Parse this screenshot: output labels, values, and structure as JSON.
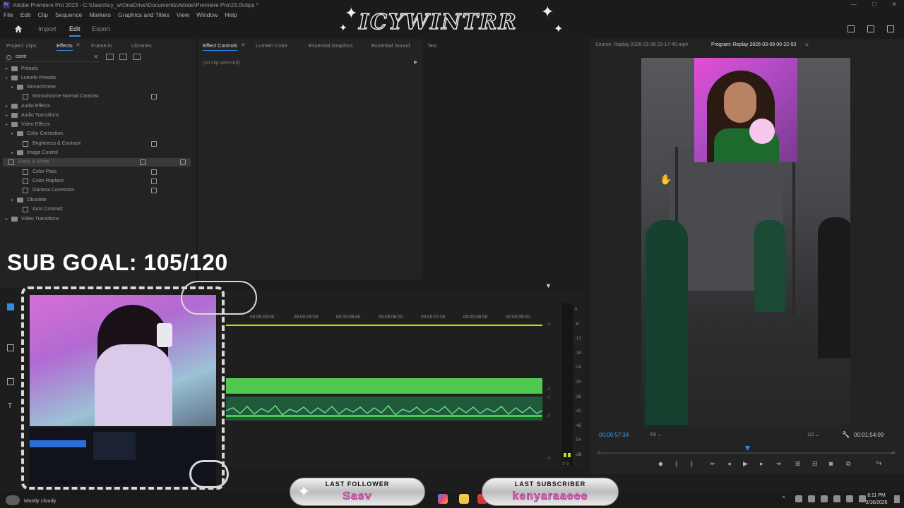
{
  "window": {
    "app_icon": "Pr",
    "title": "Adobe Premiere Pro 2023 - C:\\Users\\icy_w\\OneDrive\\Documents\\Adobe\\Premiere Pro\\23.0\\clips *",
    "controls": [
      "—",
      "□",
      "✕"
    ]
  },
  "menu": [
    "File",
    "Edit",
    "Clip",
    "Sequence",
    "Markers",
    "Graphics and Titles",
    "View",
    "Window",
    "Help"
  ],
  "workspace": {
    "tabs": [
      "Import",
      "Edit",
      "Export"
    ],
    "active_tab": "Edit",
    "banner": "ICYWINTRR"
  },
  "effects_panel": {
    "tabs": [
      "Project: clips",
      "Effects",
      "Frame.io",
      "Libraries"
    ],
    "active_tab": "Effects",
    "search_value": "contr",
    "tree": [
      {
        "label": "Presets",
        "level": 0,
        "type": "folder",
        "badge": false
      },
      {
        "label": "Lumetri Presets",
        "level": 0,
        "type": "folder",
        "badge": false
      },
      {
        "label": "Monochrome",
        "level": 1,
        "type": "folder",
        "badge": false
      },
      {
        "label": "Monochrome Normal Contrast",
        "level": 2,
        "type": "effect",
        "badge": true
      },
      {
        "label": "Audio Effects",
        "level": 0,
        "type": "folder",
        "badge": false
      },
      {
        "label": "Audio Transitions",
        "level": 0,
        "type": "folder",
        "badge": false
      },
      {
        "label": "Video Effects",
        "level": 0,
        "type": "folder",
        "badge": false
      },
      {
        "label": "Color Correction",
        "level": 1,
        "type": "folder",
        "badge": false
      },
      {
        "label": "Brightness & Contrast",
        "level": 2,
        "type": "effect",
        "badge": true
      },
      {
        "label": "Image Control",
        "level": 1,
        "type": "folder",
        "badge": false
      },
      {
        "label": "Black & White",
        "level": 2,
        "type": "effect",
        "badge": true,
        "selected": true
      },
      {
        "label": "Color Pass",
        "level": 2,
        "type": "effect",
        "badge": true
      },
      {
        "label": "Color Replace",
        "level": 2,
        "type": "effect",
        "badge": true
      },
      {
        "label": "Gamma Correction",
        "level": 2,
        "type": "effect",
        "badge": true
      },
      {
        "label": "Obsolete",
        "level": 1,
        "type": "folder",
        "badge": false
      },
      {
        "label": "Auto Contrast",
        "level": 2,
        "type": "effect",
        "badge": false
      },
      {
        "label": "Video Transitions",
        "level": 0,
        "type": "folder",
        "badge": false
      }
    ]
  },
  "effect_controls": {
    "tabs": [
      "Effect Controls",
      "Lumetri Color",
      "Essential Graphics",
      "Essential Sound",
      "Text"
    ],
    "active_tab": "Effect Controls",
    "empty_label": "(no clip selected)"
  },
  "overlay": {
    "sub_goal": "SUB GOAL: 105/120"
  },
  "timeline": {
    "ruler": [
      "00:00:03:00",
      "00:00:04:00",
      "00:00:05:00",
      "00:00:06:00",
      "00:00:07:00",
      "00:00:08:00",
      "00:00:09:00"
    ],
    "meter_db": [
      "0",
      "-6",
      "-12",
      "-18",
      "-24",
      "-30",
      "-36",
      "-42",
      "-48",
      "-54",
      "-dB"
    ],
    "meter_footer": "S S"
  },
  "program_monitor": {
    "source_tab": "Source: Replay 2026-03-08 22-17-45.mp4",
    "program_tab": "Program: Replay 2026-03-09 00-22-03",
    "timecode_current": "00:00:57:34",
    "fit": "Fit",
    "resolution": "1/2",
    "timecode_duration": "00:01:54:09",
    "playhead_fraction": 0.5
  },
  "stream_overlay": {
    "last_follower_label": "LAST FOLLOWER",
    "last_follower_name": "Sasv",
    "last_subscriber_label": "LAST SUBSCRIBER",
    "last_subscriber_name": "kenyaraaeee"
  },
  "taskbar": {
    "weather": "Mostly cloudy",
    "time": "8:11 PM",
    "date": "3/16/2026"
  },
  "colors": {
    "accent": "#2d8ceb",
    "clip_video": "#4fc94f",
    "clip_audio": "#1f5a3a",
    "timecode": "#3d9ae8",
    "subscriber_name": "#f070cf"
  }
}
